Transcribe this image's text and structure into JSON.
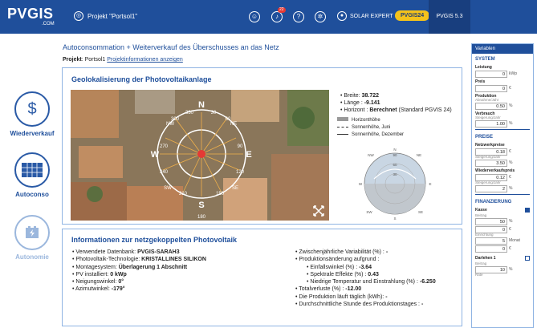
{
  "header": {
    "logo": "PVGIS",
    "logo_sub": ".COM",
    "project": "Projekt \"Portsol1\"",
    "badge": "22",
    "expert": "SOLAR EXPERT",
    "pvgis24": "PVGIS24",
    "version": "PVGIS 5.3"
  },
  "nav": [
    {
      "label": "Wiederverkauf",
      "icon": "$"
    },
    {
      "label": "Autoconso",
      "icon": ""
    },
    {
      "label": "Autonomie",
      "icon": ""
    }
  ],
  "page": {
    "title": "Autoconsommation + Weiterverkauf des Überschusses an das Netz",
    "project_label": "Projekt",
    "project_name": "Portsol1",
    "project_link": "Projektinformationen anzeigen"
  },
  "geo": {
    "title": "Geolokalisierung der Photovoltaikanlage",
    "breite_label": "Breite:",
    "breite": "38.722",
    "laenge_label": "Länge :",
    "laenge": "-9.141",
    "horizont_label": "Horizont :",
    "horizont": "Berechnet",
    "horizont_suffix": "(Standard PGVIS 24)",
    "legend": [
      "Horizonthöhe",
      "Sonnenhöhe, Juni",
      "Sonnenhöhe, Dezember"
    ],
    "compass": [
      "N",
      "NE",
      "E",
      "SE",
      "S",
      "SW",
      "W",
      "NW"
    ],
    "compass_extra": [
      "30",
      "60",
      "90",
      "120",
      "150",
      "180",
      "210",
      "240",
      "270",
      "300",
      "330"
    ],
    "polar_labels": [
      "N",
      "NW",
      "NE",
      "E",
      "W",
      "SW",
      "SE",
      "S",
      "90",
      "60",
      "30"
    ]
  },
  "info": {
    "title": "Informationen zur netzgekoppelten Photovoltaik",
    "left": [
      {
        "label": "Verwendete Datenbank:",
        "value": "PVGIS-SARAH3"
      },
      {
        "label": "Photovoltaik-Technologie:",
        "value": "KRISTALLINES SILIKON"
      },
      {
        "label": "Montagesystem:",
        "value": "Überlagerung 1 Abschnitt"
      },
      {
        "label": "PV installiert:",
        "value": "0 kWp"
      },
      {
        "label": "Neigungswinkel:",
        "value": "0°"
      },
      {
        "label": "Azimutwinkel:",
        "value": "-179°"
      }
    ],
    "right": [
      {
        "label": "Zwischenjährliche Variabilität (%) :",
        "value": "-"
      },
      {
        "label": "Produktionsänderung aufgrund :",
        "value": ""
      },
      {
        "label": "Einfallswinkel (%) :",
        "value": "-3.64",
        "sub": true
      },
      {
        "label": "Spektrale Effekte (%) :",
        "value": "0.43",
        "sub": true
      },
      {
        "label": "Niedrige Temperatur und Einstrahlung (%) :",
        "value": "-6.250",
        "sub": true
      },
      {
        "label": "Totalverluste (%) :",
        "value": "-12.00"
      },
      {
        "label": "Die Produktion läuft täglich (kWh):",
        "value": "-"
      },
      {
        "label": "Durchschnittliche Stunde des Produktionstages :",
        "value": "-"
      }
    ]
  },
  "sidebar": {
    "head": "Variablen",
    "system": "SYSTEM",
    "leistung": "Leistung",
    "leistung_val": "0",
    "leistung_unit": "kWp",
    "preis": "Preis",
    "preis_val": "0",
    "preis_unit": "€",
    "produktion": "Produktion",
    "produktion_sub": "Abnahme/Jahr",
    "produktion_val": "0.50",
    "produktion_unit": "%",
    "verbrauch": "Verbrauch",
    "verbrauch_sub": "Steigerung/Jahr",
    "verbrauch_val": "1.00",
    "verbrauch_unit": "%",
    "preise": "PREISE",
    "netz": "Netzwerkpreise",
    "netz_val": "0.18",
    "netz_unit": "€",
    "netz_sub": "Steigerung/Jahr",
    "netz2_val": "3.50",
    "netz2_unit": "%",
    "wieder": "Wiederverkaufspreis",
    "wieder_val": "0.12",
    "wieder_unit": "€",
    "wieder_sub": "Steigerung/Jahr",
    "wieder2_val": "2",
    "wieder2_unit": "%",
    "finanz": "FINANZIERUNG",
    "kasse": "Kasse",
    "betrag": "Beitrag",
    "betrag_val": "50",
    "betrag_unit": "%",
    "einricht": "Einrichtung",
    "einricht_val": "5",
    "einricht_unit": "Monat",
    "einricht2_val": "0",
    "einricht2_unit": "€",
    "darlehen": "Darlehen 1",
    "betrag2": "Beitrag",
    "betrag2_val": "10",
    "betrag2_unit": "%",
    "betrag3_val": "0",
    "betrag3_unit": "€",
    "rate": "Rate"
  }
}
